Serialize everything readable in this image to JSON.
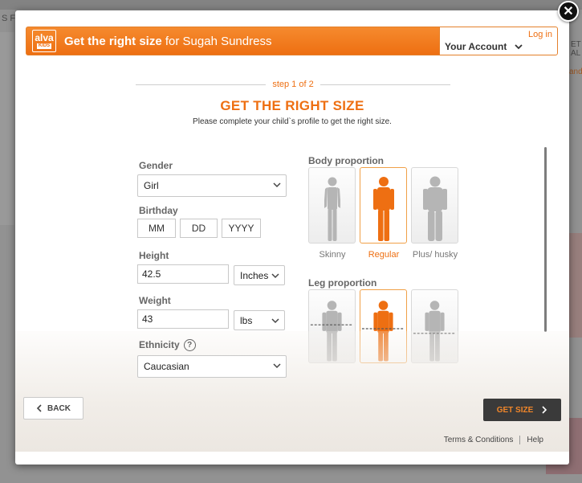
{
  "modal": {
    "header": {
      "logo_main": "alva",
      "logo_sub": "KIDS",
      "title_bold": "Get the right size",
      "title_rest": "for Sugah Sundress",
      "login_link": "Log in",
      "account_label": "Your Account"
    },
    "step": "step 1 of 2",
    "title": "GET THE RIGHT SIZE",
    "subtitle": "Please complete your child`s profile to get the right size.",
    "gender": {
      "label": "Gender",
      "value": "Girl"
    },
    "birthday": {
      "label": "Birthday",
      "month_placeholder": "MM",
      "day_placeholder": "DD",
      "year_placeholder": "YYYY"
    },
    "height": {
      "label": "Height",
      "value": "42.5",
      "unit": "Inches"
    },
    "weight": {
      "label": "Weight",
      "value": "43",
      "unit": "lbs"
    },
    "ethnicity": {
      "label": "Ethnicity",
      "value": "Caucasian",
      "help_icon": "?"
    },
    "body_proportion": {
      "label": "Body proportion",
      "options": [
        "Skinny",
        "Regular",
        "Plus/ husky"
      ],
      "selected": "Regular"
    },
    "leg_proportion": {
      "label": "Leg proportion",
      "selected_index": 1
    },
    "buttons": {
      "back": "BACK",
      "get_size": "GET SIZE"
    },
    "footer": {
      "terms": "Terms & Conditions",
      "help": "Help"
    },
    "colors": {
      "accent": "#ee6f12",
      "figure_gray": "#b5b5b5",
      "button_dark": "#3a3a3a"
    }
  },
  "background": {
    "fragment_left": "S F",
    "fragment_right_1": "ET AL",
    "fragment_right_2": "and"
  }
}
